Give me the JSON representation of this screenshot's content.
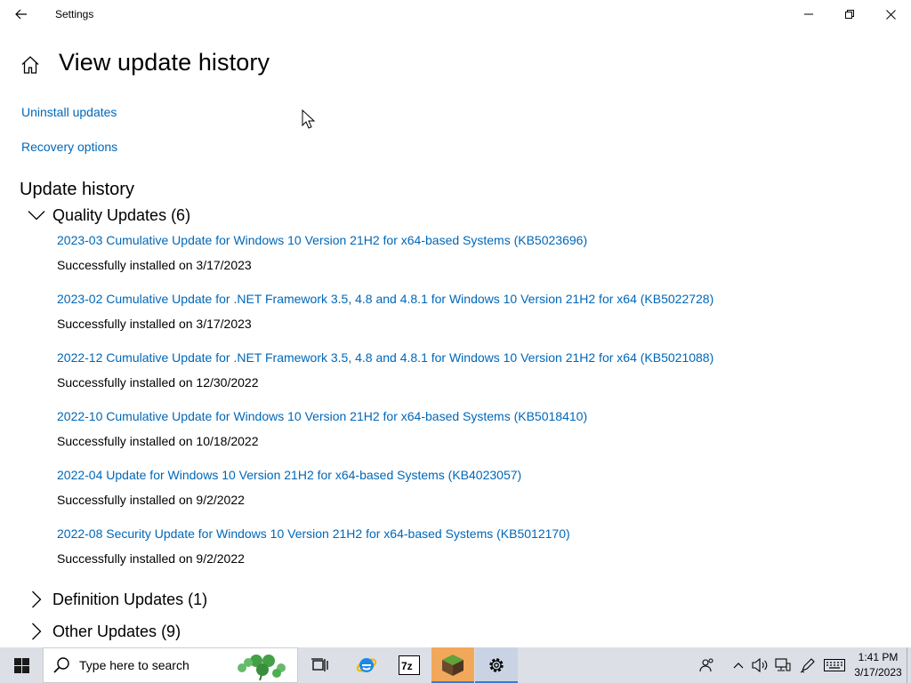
{
  "window": {
    "title": "Settings"
  },
  "page": {
    "title": "View update history",
    "links": {
      "uninstall": "Uninstall updates",
      "recovery": "Recovery options"
    },
    "section_title": "Update history"
  },
  "groups": {
    "quality": {
      "label": "Quality Updates (6)",
      "expanded": true
    },
    "definition": {
      "label": "Definition Updates (1)",
      "expanded": false
    },
    "other": {
      "label": "Other Updates (9)",
      "expanded": false
    }
  },
  "updates": [
    {
      "title": "2023-03 Cumulative Update for Windows 10 Version 21H2 for x64-based Systems (KB5023696)",
      "status": "Successfully installed on 3/17/2023"
    },
    {
      "title": "2023-02 Cumulative Update for .NET Framework 3.5, 4.8 and 4.8.1 for Windows 10 Version 21H2 for x64 (KB5022728)",
      "status": "Successfully installed on 3/17/2023"
    },
    {
      "title": "2022-12 Cumulative Update for .NET Framework 3.5, 4.8 and 4.8.1 for Windows 10 Version 21H2 for x64 (KB5021088)",
      "status": "Successfully installed on 12/30/2022"
    },
    {
      "title": "2022-10 Cumulative Update for Windows 10 Version 21H2 for x64-based Systems (KB5018410)",
      "status": "Successfully installed on 10/18/2022"
    },
    {
      "title": "2022-04 Update for Windows 10 Version 21H2 for x64-based Systems (KB4023057)",
      "status": "Successfully installed on 9/2/2022"
    },
    {
      "title": "2022-08 Security Update for Windows 10 Version 21H2 for x64-based Systems (KB5012170)",
      "status": "Successfully installed on 9/2/2022"
    }
  ],
  "taskbar": {
    "search_placeholder": "Type here to search",
    "apps": [
      "task-view-icon",
      "internet-explorer-icon",
      "7zip-icon",
      "minecraft-icon",
      "settings-gear-icon"
    ],
    "clock": {
      "time": "1:41 PM",
      "date": "3/17/2023"
    }
  },
  "colors": {
    "link": "#0067b8",
    "taskbar_bg": "#dcdfe6",
    "active_app_bg": "#c9d3e3"
  }
}
